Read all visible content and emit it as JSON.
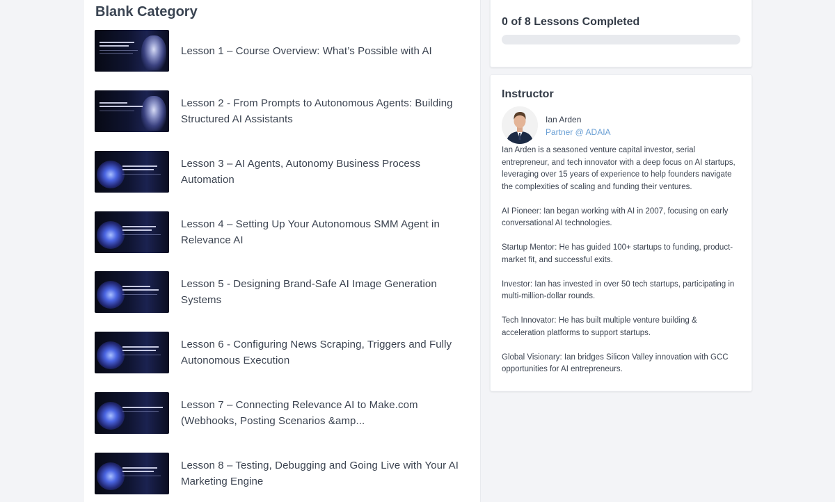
{
  "category": {
    "title": "Blank Category"
  },
  "lessons": [
    {
      "title": "Lesson 1 – Course Overview: What’s Possible with AI",
      "thumb_style": "robot",
      "thumb_icon": "robot-icon"
    },
    {
      "title": "Lesson 2 - From Prompts to Autonomous Agents: Building Structured AI Assistants",
      "thumb_style": "robot",
      "thumb_icon": "robot-icon"
    },
    {
      "title": "Lesson 3 – AI Agents, Autonomy Business Process Automation",
      "thumb_style": "brain",
      "thumb_icon": "brain-icon"
    },
    {
      "title": "Lesson 4 – Setting Up Your Autonomous SMM Agent in Relevance AI",
      "thumb_style": "brain",
      "thumb_icon": "brain-icon"
    },
    {
      "title": "Lesson 5 - Designing Brand-Safe AI Image Generation Systems",
      "thumb_style": "brain",
      "thumb_icon": "brain-icon"
    },
    {
      "title": "Lesson 6 - Configuring News Scraping, Triggers and Fully Autonomous Execution",
      "thumb_style": "brain",
      "thumb_icon": "brain-icon"
    },
    {
      "title": "Lesson 7 – Connecting Relevance AI to Make.com (Webhooks, Posting Scenarios &amp...",
      "thumb_style": "brain",
      "thumb_icon": "brain-icon"
    },
    {
      "title": "Lesson 8 – Testing, Debugging and Going Live with Your AI Marketing Engine",
      "thumb_style": "brain",
      "thumb_icon": "brain-icon"
    }
  ],
  "progress": {
    "label": "0 of 8 Lessons Completed",
    "completed": 0,
    "total": 8,
    "fraction": 0
  },
  "instructor": {
    "heading": "Instructor",
    "name": "Ian Arden",
    "role": "Partner @ ADAIA",
    "bio": [
      "Ian Arden is a seasoned venture capital investor, serial entrepreneur, and tech innovator with a deep focus on AI startups, leveraging over 15 years of experience to help founders navigate the complexities of scaling and funding their ventures.",
      "AI Pioneer: Ian began working with AI in 2007, focusing on early conversational AI technologies.",
      "Startup Mentor: He has guided 100+ startups to funding, product-market fit, and successful exits.",
      "Investor: Ian has invested in over 50 tech startups, participating in multi-million-dollar rounds.",
      "Tech Innovator: He has built multiple venture building & acceleration platforms to support startups.",
      "Global Visionary: Ian bridges Silicon Valley innovation with GCC opportunities for AI entrepreneurs."
    ]
  },
  "colors": {
    "background": "#f3f4f7",
    "card": "#ffffff",
    "accent_link": "#6a9fd4",
    "progress_track": "#e8eaee"
  }
}
